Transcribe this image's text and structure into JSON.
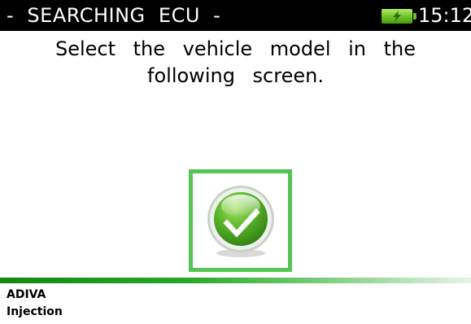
{
  "header": {
    "title": "-  SEARCHING  ECU  -",
    "time": "15:12",
    "battery_icon": "battery-charging-icon",
    "battery_color": "#6cc024"
  },
  "message": {
    "line1": "Select the vehicle model in the",
    "line2": "following screen."
  },
  "confirm": {
    "icon": "checkmark-icon",
    "accent": "#55c455"
  },
  "info": {
    "brand": "ADIVA",
    "system": "Injection"
  }
}
